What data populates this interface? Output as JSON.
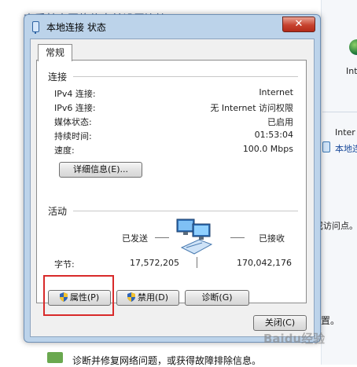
{
  "background": {
    "page_title": "查看基本网络信息并设置连接",
    "right_texts": [
      "Int",
      "Inter",
      "本地连",
      "或访问点。",
      "置。"
    ],
    "bottom_text": "诊断并修复网络问题，或获得故障排除信息。"
  },
  "window": {
    "title": "本地连接 状态",
    "close_glyph": "✕",
    "tab_general": "常规",
    "connection": {
      "group_label": "连接",
      "rows": [
        {
          "label": "IPv4 连接:",
          "value": "Internet"
        },
        {
          "label": "IPv6 连接:",
          "value": "无 Internet 访问权限"
        },
        {
          "label": "媒体状态:",
          "value": "已启用"
        },
        {
          "label": "持续时间:",
          "value": "01:53:04"
        },
        {
          "label": "速度:",
          "value": "100.0 Mbps"
        }
      ],
      "details_button": "详细信息(E)..."
    },
    "activity": {
      "group_label": "活动",
      "sent_label": "已发送",
      "received_label": "已接收",
      "bytes_label": "字节:",
      "bytes_sent": "17,572,205",
      "bytes_received": "170,042,176"
    },
    "buttons": {
      "properties": "属性(P)",
      "disable": "禁用(D)",
      "diagnose": "诊断(G)",
      "close": "关闭(C)"
    }
  },
  "watermark": "Baidu经验",
  "colors": {
    "titlebar": "#bcd3ea",
    "close_button": "#c7432f",
    "highlight_box": "#d82a2a"
  }
}
